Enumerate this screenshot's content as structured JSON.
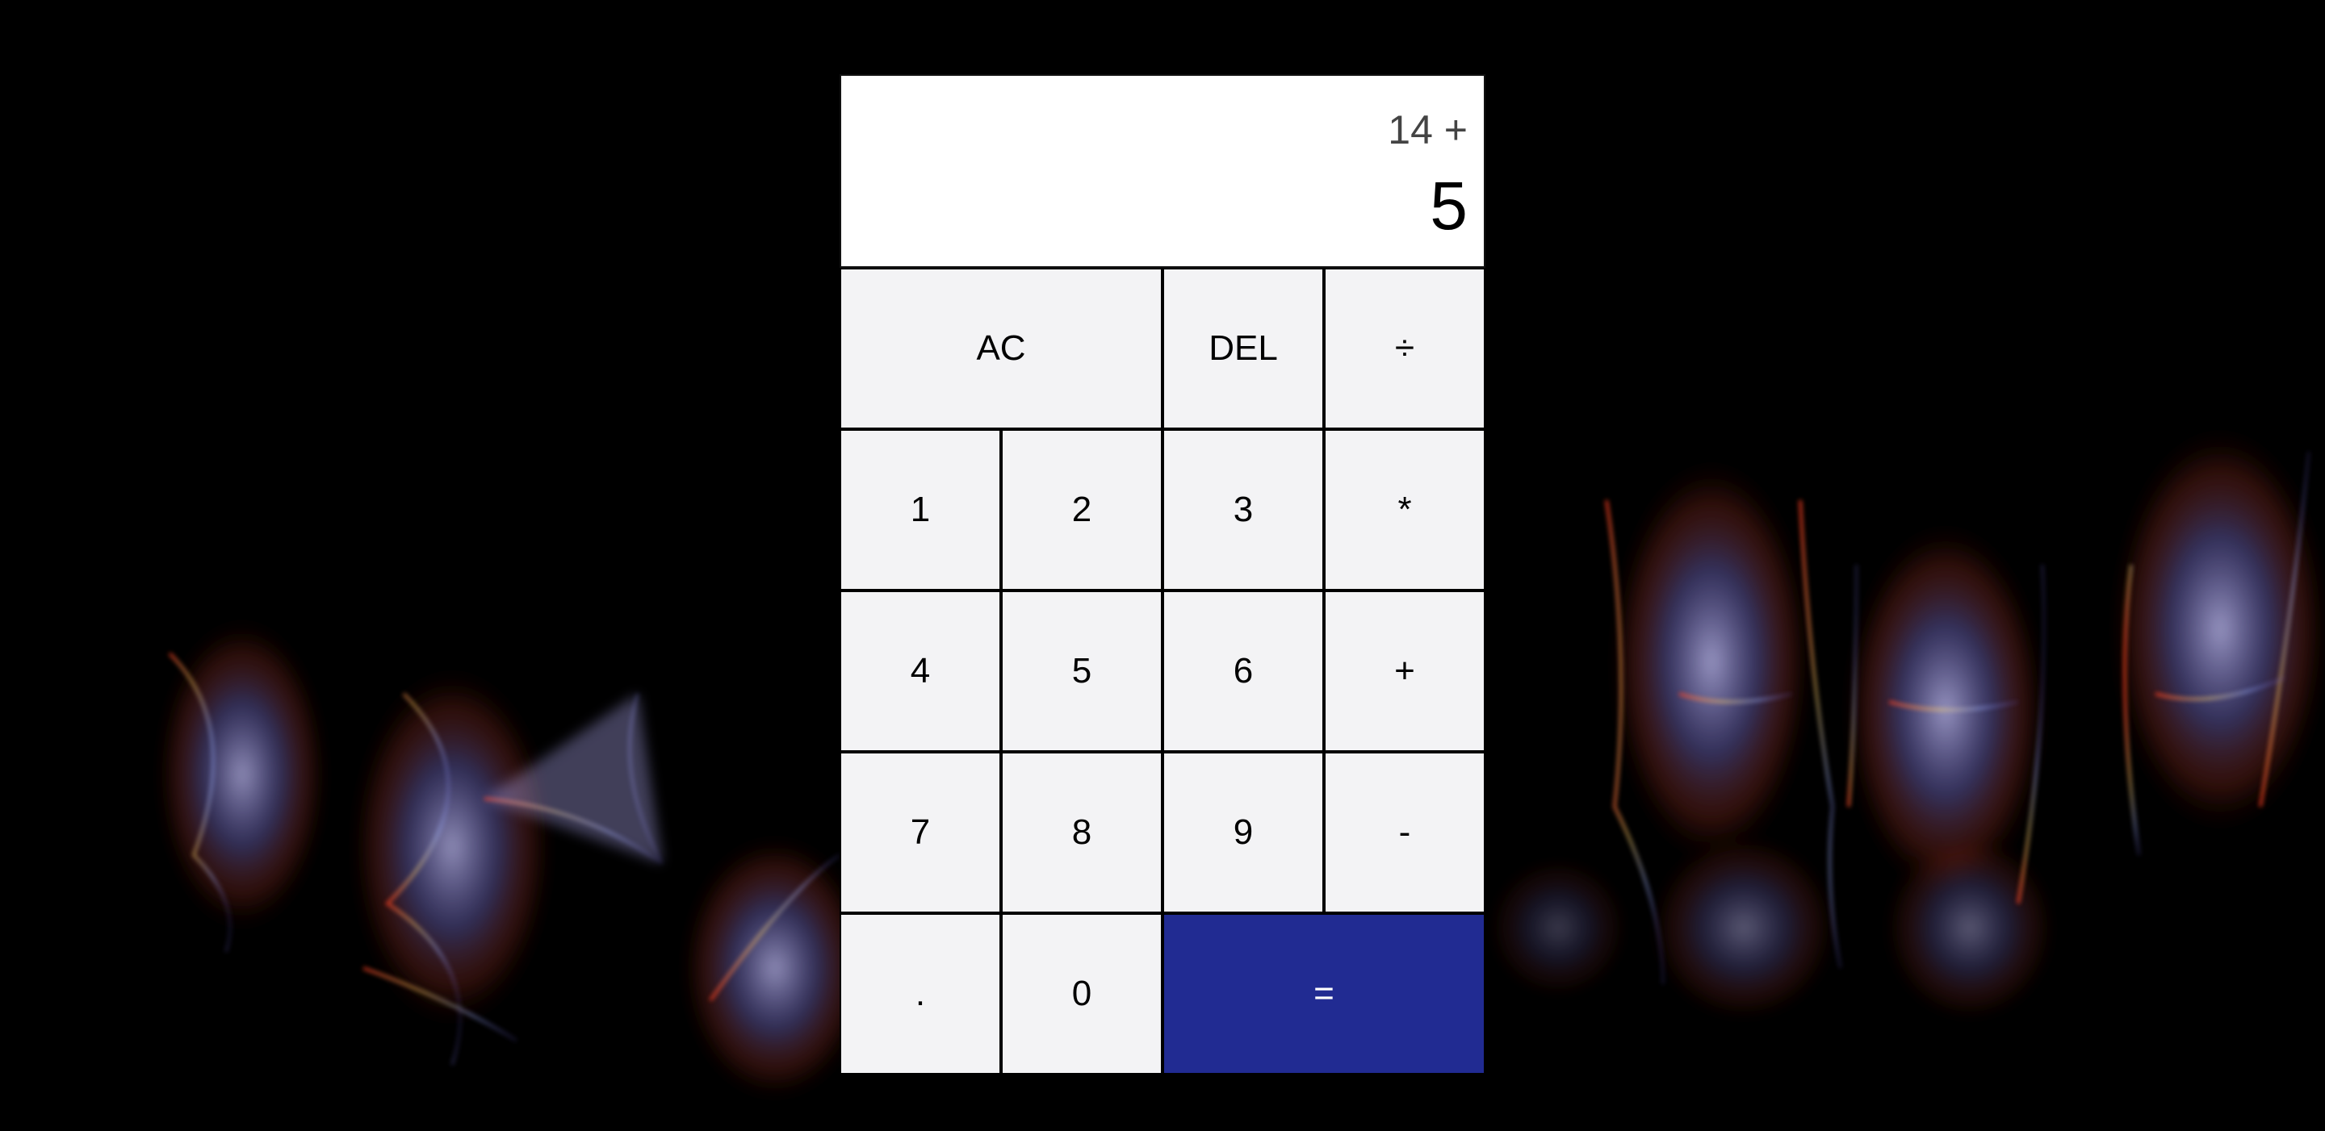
{
  "colors": {
    "background": "#000000",
    "display_bg": "#ffffff",
    "key_bg": "#f3f3f5",
    "equals_bg": "#212b92",
    "equals_text": "#ffffff"
  },
  "display": {
    "previous_operand": "14 +",
    "current_operand": "5"
  },
  "keys": {
    "all_clear": "AC",
    "delete": "DEL",
    "divide": "÷",
    "one": "1",
    "two": "2",
    "three": "3",
    "multiply": "*",
    "four": "4",
    "five": "5",
    "six": "6",
    "add": "+",
    "seven": "7",
    "eight": "8",
    "nine": "9",
    "subtract": "-",
    "decimal": ".",
    "zero": "0",
    "equals": "="
  }
}
